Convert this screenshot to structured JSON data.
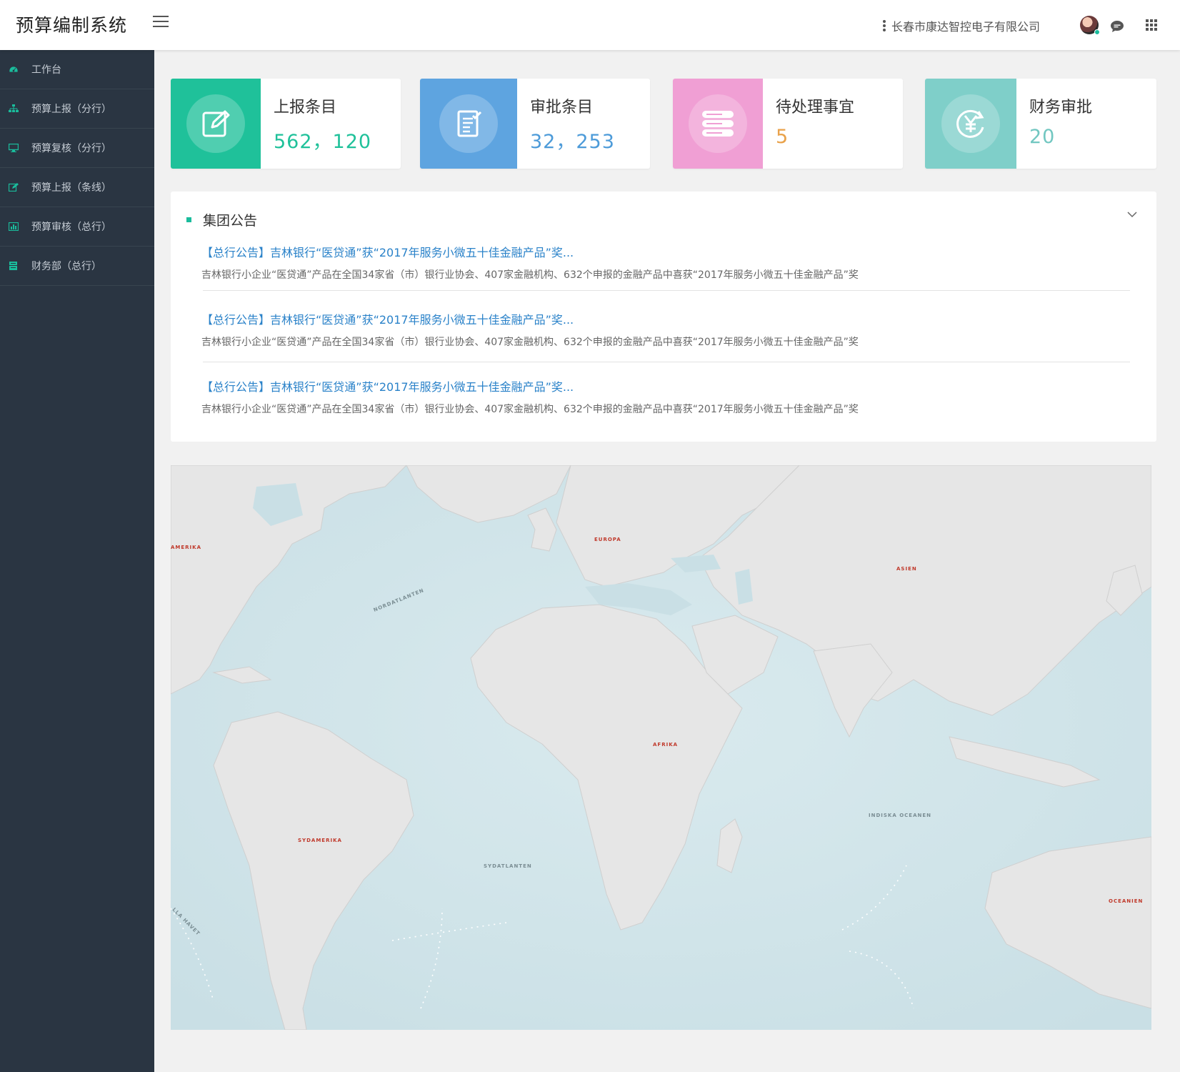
{
  "header": {
    "app_title": "预算编制系统",
    "company": "长春市康达智控电子有限公司"
  },
  "sidebar": {
    "items": [
      {
        "label": "工作台",
        "icon": "dashboard-icon"
      },
      {
        "label": "预算上报（分行）",
        "icon": "sitemap-icon"
      },
      {
        "label": "预算复核（分行）",
        "icon": "desktop-icon"
      },
      {
        "label": "预算上报（条线）",
        "icon": "edit-icon"
      },
      {
        "label": "预算审核（总行）",
        "icon": "bar-chart-icon"
      },
      {
        "label": "财务部（总行）",
        "icon": "ledger-icon"
      }
    ]
  },
  "stats": [
    {
      "title": "上报条目",
      "value": "562，120",
      "color": "#1fc19a",
      "value_color": "#1fc19a",
      "icon": "edit-icon"
    },
    {
      "title": "审批条目",
      "value": "32，253",
      "color": "#5ea4e0",
      "value_color": "#4d9bd9",
      "icon": "document-check-icon"
    },
    {
      "title": "待处理事宜",
      "value": "5",
      "color": "#f09fd4",
      "value_color": "#e9a24b",
      "icon": "list-icon"
    },
    {
      "title": "财务审批",
      "value": "20",
      "color": "#7fcfc9",
      "value_color": "#72c7c1",
      "icon": "yen-refresh-icon"
    }
  ],
  "announcements": {
    "title": "集团公告",
    "items": [
      {
        "link": "【总行公告】吉林银行“医贷通”获“2017年服务小微五十佳金融产品”奖...",
        "summary": "吉林银行小企业“医贷通”产品在全国34家省（市）银行业协会、407家金融机构、632个申报的金融产品中喜获“2017年服务小微五十佳金融产品”奖"
      },
      {
        "link": "【总行公告】吉林银行“医贷通”获“2017年服务小微五十佳金融产品”奖...",
        "summary": "吉林银行小企业“医贷通”产品在全国34家省（市）银行业协会、407家金融机构、632个申报的金融产品中喜获“2017年服务小微五十佳金融产品”奖"
      },
      {
        "link": "【总行公告】吉林银行“医贷通”获“2017年服务小微五十佳金融产品”奖...",
        "summary": "吉林银行小企业“医贷通”产品在全国34家省（市）银行业协会、407家金融机构、632个申报的金融产品中喜获“2017年服务小微五十佳金融产品”奖"
      }
    ]
  },
  "map": {
    "labels": [
      "AMERIKA",
      "EUROPA",
      "ASIEN",
      "NORDATLANTEN",
      "AFRIKA",
      "SYDAMERIKA",
      "SYDATLANTEN",
      "INDISKA OCEANEN",
      "OCEANIEN",
      "LLA HAVET"
    ]
  }
}
